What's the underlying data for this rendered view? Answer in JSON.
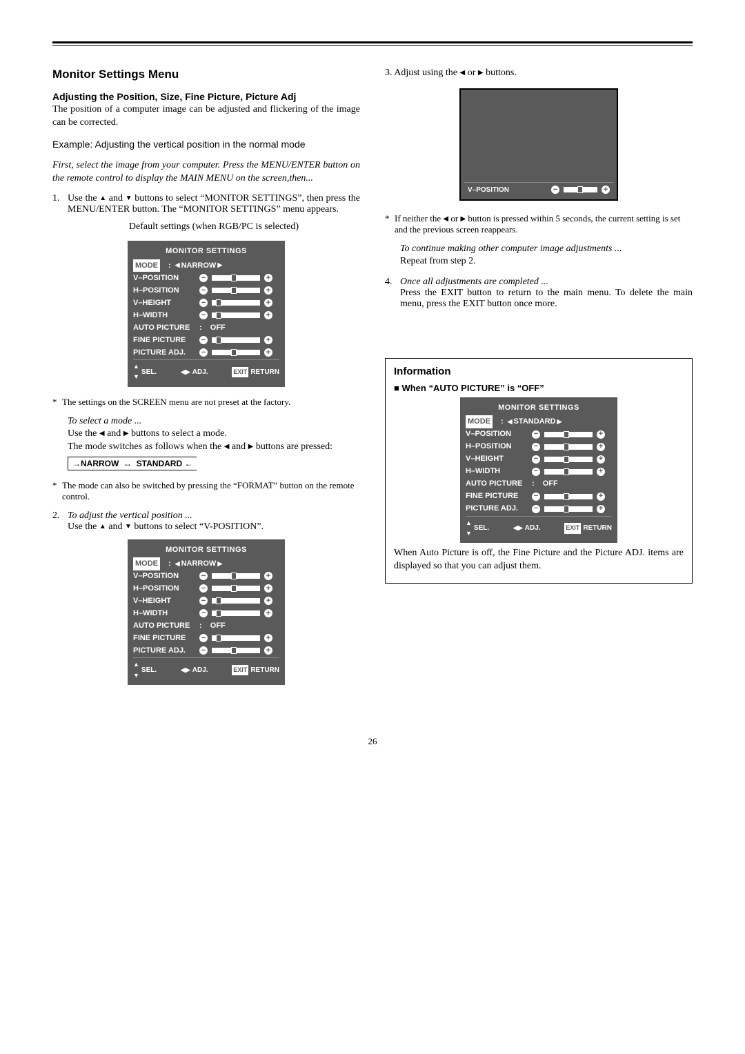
{
  "header": {
    "title": "Monitor Settings Menu",
    "subheading": "Adjusting the Position, Size, Fine Picture, Picture Adj",
    "intro": "The position of a computer image can be adjusted and flickering of the image can be corrected.",
    "example": "Example: Adjusting the vertical position in the normal mode",
    "italic_lead": "First, select the image from your computer.  Press the MENU/ENTER button on the remote control to display the MAIN MENU on the screen,then..."
  },
  "steps": {
    "s1_a": "Use the ",
    "s1_b": " and ",
    "s1_c": " buttons to select “MONITOR SETTINGS”, then press the MENU/ENTER button. The “MONITOR SETTINGS” menu appears.",
    "default_caption": "Default settings (when RGB/PC is selected)",
    "preset_note": "The settings on the SCREEN menu are not preset at the factory.",
    "select_mode_hdr": "To select a mode ...",
    "select_mode_a": "Use the ",
    "select_mode_b": " and ",
    "select_mode_c": " buttons to select a mode.",
    "select_mode_d": "The mode switches as follows when the ",
    "select_mode_e": " buttons are pressed:",
    "mode_a": "NARROW",
    "mode_arrow": "↔",
    "mode_b": "STANDARD",
    "format_note": "The mode can also be switched by pressing the “FORMAT” button on the remote control.",
    "s2_hdr": "To adjust the vertical position ...",
    "s2_a": "Use the ",
    "s2_b": " buttons to select “V-POSITION”."
  },
  "right": {
    "s3_a": "3. Adjust using the ",
    "s3_b": " or ",
    "s3_c": " buttons.",
    "neither_a": "If neither the ",
    "neither_b": " or ",
    "neither_c": " button is pressed within 5 seconds, the current setting is set and the previous screen reappears.",
    "cont_i": "To continue making other computer image adjustments ...",
    "cont_repeat": "Repeat from step 2.",
    "s4_hdr": "Once all adjustments are completed ...",
    "s4_body": "Press the EXIT button to return to the main menu. To delete the main menu, press the EXIT button once more."
  },
  "osd": {
    "title": "MONITOR SETTINGS",
    "mode_label": "MODE",
    "mode_value_narrow": "NARROW",
    "mode_value_standard": "STANDARD",
    "rows": {
      "vpos": "V–POSITION",
      "hpos": "H–POSITION",
      "vheight": "V–HEIGHT",
      "hwidth": "H–WIDTH",
      "autopic": "AUTO PICTURE",
      "autopic_val": "OFF",
      "finepic": "FINE PICTURE",
      "picadj": "PICTURE ADJ."
    },
    "foot": {
      "sel": "SEL.",
      "adj": "ADJ.",
      "exit": "EXIT",
      "return": "RETURN"
    }
  },
  "info": {
    "title": "Information",
    "sub": "■ When “AUTO PICTURE” is “OFF”",
    "body": "When Auto Picture is off, the Fine Picture and the Picture ADJ. items are displayed so that you can adjust them."
  },
  "page": "26"
}
